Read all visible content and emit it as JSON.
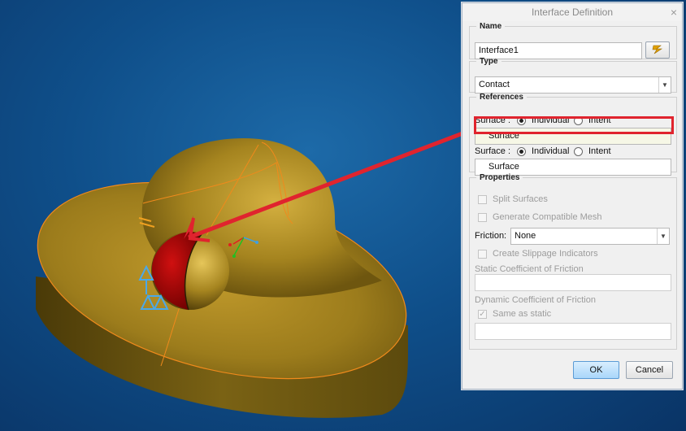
{
  "dialog": {
    "title": "Interface Definition",
    "close_label": "×"
  },
  "name_group": {
    "legend": "Name",
    "value": "Interface1",
    "button_icon": "lightning-icon"
  },
  "type_group": {
    "legend": "Type",
    "selected": "Contact"
  },
  "references": {
    "legend": "References",
    "surface1_label": "Surface :",
    "surface1_option_individual": "Individual",
    "surface1_option_intent": "Intent",
    "surface1_value": "Surface",
    "surface2_label": "Surface :",
    "surface2_option_individual": "Individual",
    "surface2_option_intent": "Intent",
    "surface2_value": "Surface"
  },
  "properties": {
    "legend": "Properties",
    "split_surfaces": "Split Surfaces",
    "generate_mesh": "Generate Compatible Mesh",
    "friction_label": "Friction:",
    "friction_value": "None",
    "slippage": "Create Slippage Indicators",
    "static_label": "Static Coefficient of Friction",
    "dynamic_label": "Dynamic Coefficient of Friction",
    "same_as_static": "Same as static"
  },
  "buttons": {
    "ok": "OK",
    "cancel": "Cancel"
  },
  "colors": {
    "model": "#a8861f",
    "highlight": "#e0242e",
    "background": "#0f4f8a"
  }
}
